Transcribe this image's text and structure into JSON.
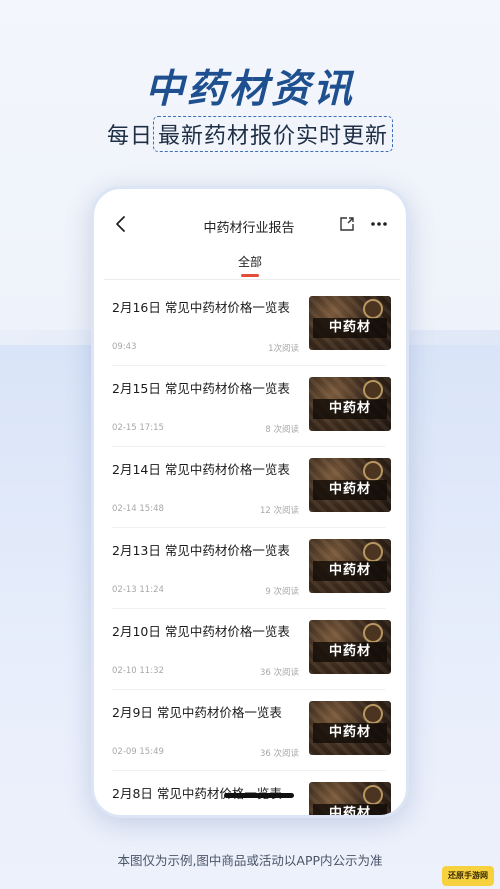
{
  "promo": {
    "headline": "中药材资讯",
    "sub_prefix": "每日",
    "sub_boxed": "最新药材报价实时更新",
    "disclaimer": "本图仅为示例,图中商品或活动以APP内公示为准"
  },
  "app": {
    "nav_title": "中药材行业报告",
    "back_icon": "chevron-left-icon",
    "share_icon": "share-icon",
    "more_icon": "more-dots-icon",
    "more_label": "···",
    "tab_label": "全部",
    "accent_color": "#e34b3a",
    "thumbnail_text": "中药材"
  },
  "articles": [
    {
      "title": "2月16日 常见中药材价格一览表",
      "time": "09:43",
      "reads": "1次阅读"
    },
    {
      "title": "2月15日 常见中药材价格一览表",
      "time": "02-15 17:15",
      "reads": "8 次阅读"
    },
    {
      "title": "2月14日 常见中药材价格一览表",
      "time": "02-14 15:48",
      "reads": "12 次阅读"
    },
    {
      "title": "2月13日 常见中药材价格一览表",
      "time": "02-13 11:24",
      "reads": "9 次阅读"
    },
    {
      "title": "2月10日 常见中药材价格一览表",
      "time": "02-10 11:32",
      "reads": "36 次阅读"
    },
    {
      "title": "2月9日 常见中药材价格一览表",
      "time": "02-09 15:49",
      "reads": "36 次阅读"
    },
    {
      "title": "2月8日 常见中药材价格一览表",
      "time": "",
      "reads": ""
    }
  ],
  "watermark": "还原手游网"
}
